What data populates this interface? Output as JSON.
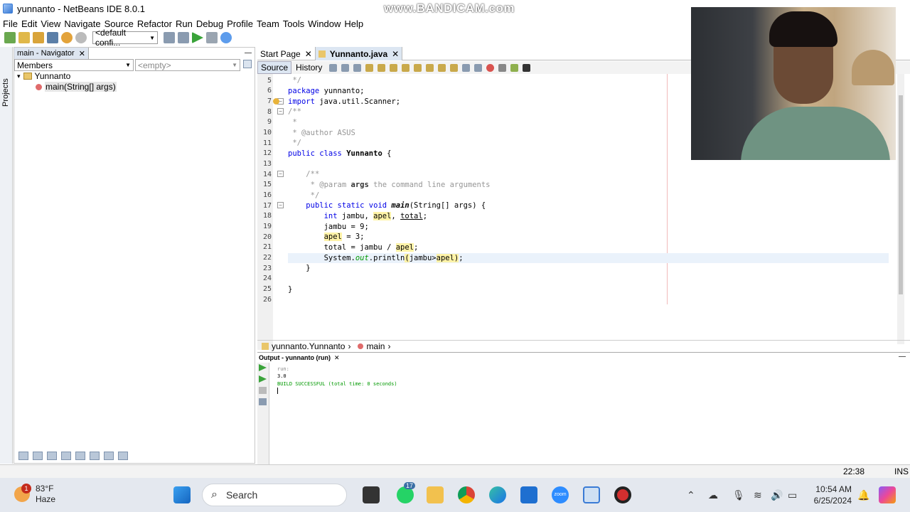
{
  "titlebar": {
    "title": "yunnanto - NetBeans IDE 8.0.1",
    "watermark": "www.BANDICAM.com"
  },
  "menu": [
    "File",
    "Edit",
    "View",
    "Navigate",
    "Source",
    "Refactor",
    "Run",
    "Debug",
    "Profile",
    "Team",
    "Tools",
    "Window",
    "Help"
  ],
  "toolbar": {
    "config": "<default confi..."
  },
  "leftstrip": {
    "label": "Projects"
  },
  "navigator": {
    "tab": "main - Navigator",
    "members_select": "Members",
    "empty_select": "<empty>",
    "tree": {
      "class": "Yunnanto",
      "method": "main(String[] args)"
    }
  },
  "editor": {
    "tabs": [
      "Start Page",
      "Yunnanto.java"
    ],
    "source_btn": "Source",
    "history_btn": "History",
    "line_numbers": [
      "5",
      "6",
      "7",
      "8",
      "9",
      "10",
      "11",
      "12",
      "13",
      "14",
      "15",
      "16",
      "17",
      "18",
      "19",
      "20",
      "21",
      "22",
      "23",
      "24",
      "25",
      "26"
    ],
    "breadcrumb": {
      "cls": "yunnanto.Yunnanto",
      "method": "main"
    }
  },
  "output": {
    "tab": "Output - yunnanto (run)",
    "lines": [
      "run:",
      "3.0",
      "BUILD SUCCESSFUL (total time: 0 seconds)"
    ]
  },
  "status": {
    "time": "22:38",
    "mode": "INS"
  },
  "taskbar": {
    "weather_temp": "83°F",
    "weather_desc": "Haze",
    "weather_badge": "1",
    "search_placeholder": "Search",
    "whatsapp_badge": "17",
    "zoom_label": "zoom",
    "clock_time": "10:54 AM",
    "clock_date": "6/25/2024"
  },
  "colors": {
    "keyword": "#0000e6",
    "comment": "#969696",
    "highlight": "#fff3a8",
    "build_ok": "#009900"
  }
}
